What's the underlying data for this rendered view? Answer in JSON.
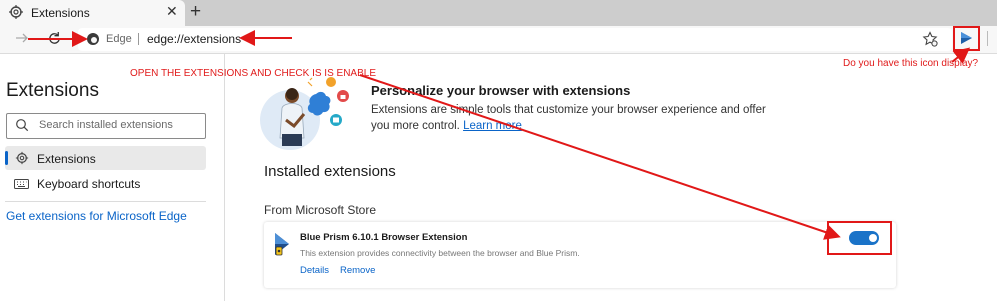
{
  "browser": {
    "tab_title": "Extensions",
    "tab_close": "✕",
    "new_tab": "+",
    "address_label": "Edge",
    "url": "edge://extensions"
  },
  "sidebar": {
    "title": "Extensions",
    "search_placeholder": "Search installed extensions",
    "items": [
      {
        "label": "Extensions",
        "icon": "gear-icon",
        "selected": true
      },
      {
        "label": "Keyboard shortcuts",
        "icon": "keyboard-icon",
        "selected": false
      }
    ],
    "get_extensions_link": "Get extensions for Microsoft Edge"
  },
  "banner": {
    "title": "Personalize your browser with extensions",
    "description": "Extensions are simple tools that customize your browser experience and offer you more control.",
    "learn_more": "Learn more"
  },
  "main": {
    "installed_heading": "Installed extensions",
    "source_heading": "From Microsoft Store",
    "extension": {
      "name": "Blue Prism 6.10.1 Browser Extension",
      "description": "This extension provides connectivity between the browser and Blue Prism.",
      "details_link": "Details",
      "remove_link": "Remove",
      "enabled": true
    }
  },
  "annotations": {
    "instruction": "OPEN THE EXTENSIONS AND CHECK IS IS ENABLE",
    "question": "Do you have this icon display?",
    "color": "#e11818"
  },
  "colors": {
    "accent": "#0a64c8",
    "toggle_on": "#1a73c8",
    "annotation": "#e11818"
  }
}
